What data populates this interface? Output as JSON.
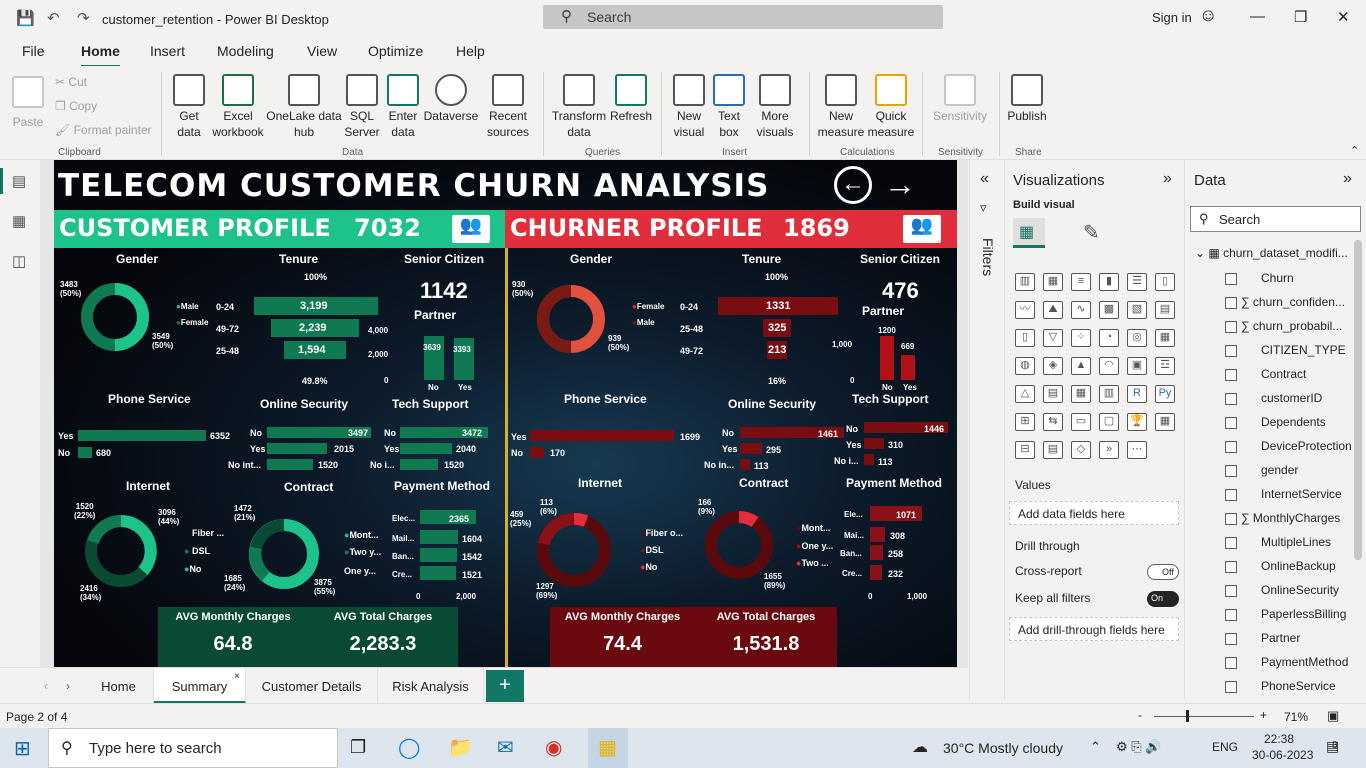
{
  "window": {
    "title": "customer_retention - Power BI Desktop",
    "search_placeholder": "Search",
    "sign_in": "Sign in"
  },
  "menu": [
    "File",
    "Home",
    "Insert",
    "Modeling",
    "View",
    "Optimize",
    "Help"
  ],
  "ribbon": {
    "clipboard": {
      "paste": "Paste",
      "cut": "Cut",
      "copy": "Copy",
      "format_painter": "Format painter",
      "group": "Clipboard"
    },
    "data": {
      "get_data": "Get data",
      "excel": "Excel workbook",
      "onelake": "OneLake data hub",
      "sql": "SQL Server",
      "enter": "Enter data",
      "dataverse": "Dataverse",
      "recent": "Recent sources",
      "group": "Data"
    },
    "queries": {
      "transform": "Transform data",
      "refresh": "Refresh",
      "group": "Queries"
    },
    "insert": {
      "new_visual": "New visual",
      "text_box": "Text box",
      "more_visuals": "More visuals",
      "group": "Insert"
    },
    "calc": {
      "new_measure": "New measure",
      "quick_measure": "Quick measure",
      "group": "Calculations"
    },
    "sens": {
      "label": "Sensitivity",
      "group": "Sensitivity"
    },
    "share": {
      "publish": "Publish",
      "group": "Share"
    }
  },
  "report": {
    "title": "TELECOM CUSTOMER CHURN ANALYSIS",
    "left": {
      "header": "CUSTOMER PROFILE",
      "count": "7032",
      "gender": {
        "title": "Gender",
        "male_label": "3483\n(50%)",
        "female_label": "3549\n(50%)",
        "legend": [
          "Male",
          "Female"
        ]
      },
      "tenure": {
        "title": "Tenure",
        "top": "100%",
        "bottom": "49.8%",
        "rows": [
          {
            "label": "0-24",
            "value": "3,199"
          },
          {
            "label": "49-72",
            "value": "2,239"
          },
          {
            "label": "25-48",
            "value": "1,594"
          }
        ],
        "axis": [
          "4,000",
          "2,000",
          "0"
        ]
      },
      "senior": {
        "title": "Senior Citizen",
        "value": "1142"
      },
      "partner": {
        "title": "Partner",
        "no": "3639",
        "yes": "3393",
        "labels": [
          "No",
          "Yes"
        ]
      },
      "phone": {
        "title": "Phone Service",
        "rows": [
          {
            "label": "Yes",
            "value": "6352"
          },
          {
            "label": "No",
            "value": "680"
          }
        ]
      },
      "security": {
        "title": "Online Security",
        "rows": [
          {
            "label": "No",
            "value": "3497"
          },
          {
            "label": "Yes",
            "value": "2015"
          },
          {
            "label": "No int...",
            "value": "1520"
          }
        ]
      },
      "tech": {
        "title": "Tech Support",
        "rows": [
          {
            "label": "No",
            "value": "3472"
          },
          {
            "label": "Yes",
            "value": "2040"
          },
          {
            "label": "No i...",
            "value": "1520"
          }
        ]
      },
      "internet": {
        "title": "Internet",
        "labels": [
          "1520\n(22%)",
          "3096\n(44%)",
          "2416\n(34%)"
        ],
        "legend": [
          "Fiber ...",
          "DSL",
          "No"
        ]
      },
      "contract": {
        "title": "Contract",
        "labels": [
          "1472\n(21%)",
          "1685\n(24%)",
          "3875\n(55%)"
        ],
        "legend": [
          "Mont...",
          "Two y...",
          "One y..."
        ]
      },
      "payment": {
        "title": "Payment Method",
        "rows": [
          {
            "label": "Elec...",
            "value": "2365"
          },
          {
            "label": "Mail...",
            "value": "1604"
          },
          {
            "label": "Ban...",
            "value": "1542"
          },
          {
            "label": "Cre...",
            "value": "1521"
          }
        ],
        "axis": [
          "0",
          "2,000"
        ]
      },
      "kpi": {
        "avg_monthly_label": "AVG Monthly Charges",
        "avg_monthly": "64.8",
        "avg_total_label": "AVG Total Charges",
        "avg_total": "2,283.3"
      }
    },
    "right": {
      "header": "CHURNER PROFILE",
      "count": "1869",
      "gender": {
        "title": "Gender",
        "female_label": "930\n(50%)",
        "male_label": "939\n(50%)",
        "legend": [
          "Female",
          "Male"
        ]
      },
      "tenure": {
        "title": "Tenure",
        "top": "100%",
        "bottom": "16%",
        "rows": [
          {
            "label": "0-24",
            "value": "1331"
          },
          {
            "label": "25-48",
            "value": "325"
          },
          {
            "label": "49-72",
            "value": "213"
          }
        ]
      },
      "senior": {
        "title": "Senior Citizen",
        "value": "476"
      },
      "partner": {
        "title": "Partner",
        "no": "1200",
        "yes": "669",
        "axis": [
          "1,000",
          "0"
        ],
        "labels": [
          "No",
          "Yes"
        ]
      },
      "phone": {
        "title": "Phone Service",
        "rows": [
          {
            "label": "Yes",
            "value": "1699"
          },
          {
            "label": "No",
            "value": "170"
          }
        ]
      },
      "security": {
        "title": "Online Security",
        "rows": [
          {
            "label": "No",
            "value": "1461"
          },
          {
            "label": "Yes",
            "value": "295"
          },
          {
            "label": "No in...",
            "value": "113"
          }
        ]
      },
      "tech": {
        "title": "Tech Support",
        "rows": [
          {
            "label": "No",
            "value": "1446"
          },
          {
            "label": "Yes",
            "value": "310"
          },
          {
            "label": "No i...",
            "value": "113"
          }
        ]
      },
      "internet": {
        "title": "Internet",
        "labels": [
          "113\n(6%)",
          "459\n(25%)",
          "1297\n(69%)"
        ],
        "legend": [
          "Fiber o...",
          "DSL",
          "No"
        ]
      },
      "contract": {
        "title": "Contract",
        "labels": [
          "166\n(9%)",
          "1655\n(89%)"
        ],
        "legend": [
          "Mont...",
          "One y...",
          "Two ..."
        ]
      },
      "payment": {
        "title": "Payment Method",
        "rows": [
          {
            "label": "Ele...",
            "value": "1071"
          },
          {
            "label": "Mai...",
            "value": "308"
          },
          {
            "label": "Ban...",
            "value": "258"
          },
          {
            "label": "Cre...",
            "value": "232"
          }
        ],
        "axis": [
          "0",
          "1,000"
        ]
      },
      "kpi": {
        "avg_monthly_label": "AVG Monthly Charges",
        "avg_monthly": "74.4",
        "avg_total_label": "AVG Total Charges",
        "avg_total": "1,531.8"
      }
    }
  },
  "filters_label": "Filters",
  "viz": {
    "title": "Visualizations",
    "build": "Build visual",
    "values": "Values",
    "add_fields": "Add data fields here",
    "drill": "Drill through",
    "cross_report": "Cross-report",
    "cross_state": "Off",
    "keep_filters": "Keep all filters",
    "keep_state": "On",
    "add_drill": "Add drill-through fields here"
  },
  "data_pane": {
    "title": "Data",
    "search_placeholder": "Search",
    "table": "churn_dataset_modifi...",
    "fields": [
      "Churn",
      "churn_confiden...",
      "churn_probabil...",
      "CITIZEN_TYPE",
      "Contract",
      "customerID",
      "Dependents",
      "DeviceProtection",
      "gender",
      "InternetService",
      "MonthlyCharges",
      "MultipleLines",
      "OnlineBackup",
      "OnlineSecurity",
      "PaperlessBilling",
      "Partner",
      "PaymentMethod",
      "PhoneService"
    ],
    "sigma": [
      false,
      true,
      true,
      false,
      false,
      false,
      false,
      false,
      false,
      false,
      true,
      false,
      false,
      false,
      false,
      false,
      false,
      false
    ]
  },
  "tabs": [
    "Home",
    "Summary",
    "Customer Details",
    "Risk Analysis"
  ],
  "status": {
    "page": "Page 2 of 4",
    "zoom": "71%"
  },
  "taskbar": {
    "search": "Type here to search",
    "weather": "30°C  Mostly cloudy",
    "lang": "ENG",
    "time": "22:38",
    "date": "30-06-2023",
    "notif": "8"
  },
  "colors": {
    "green": "#1ec28b",
    "green_dark": "#0f7a52",
    "red": "#e02f3a",
    "red_dark": "#7a0d12",
    "accent": "#117865"
  }
}
